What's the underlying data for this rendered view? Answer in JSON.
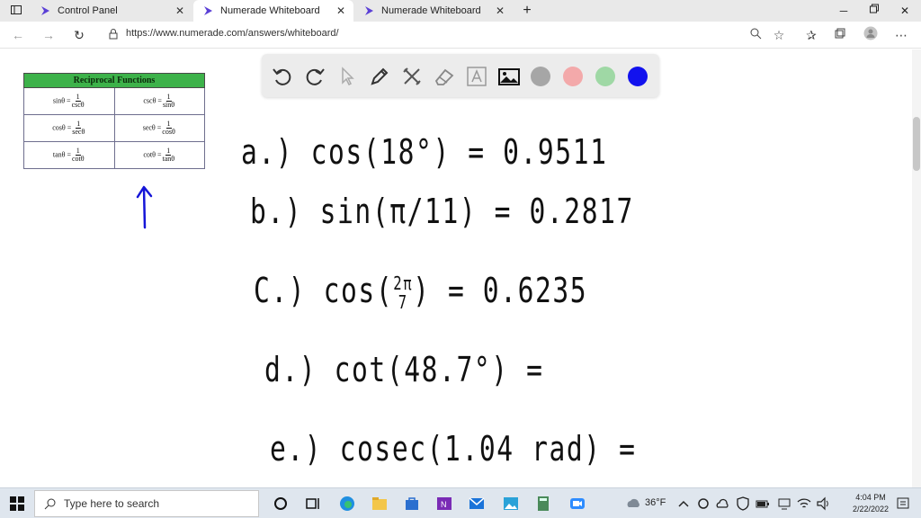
{
  "tabs": [
    {
      "title": "Control Panel"
    },
    {
      "title": "Numerade Whiteboard"
    },
    {
      "title": "Numerade Whiteboard"
    }
  ],
  "address": {
    "url": "https://www.numerade.com/answers/whiteboard/"
  },
  "table": {
    "title": "Reciprocal Functions",
    "rows": [
      {
        "l_lhs": "sinθ =",
        "l_num": "1",
        "l_den": "cscθ",
        "r_lhs": "cscθ =",
        "r_num": "1",
        "r_den": "sinθ"
      },
      {
        "l_lhs": "cosθ =",
        "l_num": "1",
        "l_den": "secθ",
        "r_lhs": "secθ =",
        "r_num": "1",
        "r_den": "cosθ"
      },
      {
        "l_lhs": "tanθ =",
        "l_num": "1",
        "l_den": "cotθ",
        "r_lhs": "cotθ =",
        "r_num": "1",
        "r_den": "tanθ"
      }
    ]
  },
  "toolbar": {
    "colors": {
      "gray": "#a6a6a6",
      "pink": "#f3a9aa",
      "green": "#9fd8a5",
      "blue": "#1212ee"
    }
  },
  "work": {
    "a": "a.) cos(18°) = 0.9511",
    "b": "b.) sin(π/11) = 0.2817",
    "c_pre": "C.) cos(",
    "c_num": "2π",
    "c_den": "7",
    "c_post": ") = 0.6235",
    "d": "d.) cot(48.7°) =",
    "e": "e.) cosec(1.04 rad) ="
  },
  "taskbar": {
    "search_placeholder": "Type here to search",
    "temperature": "36°F",
    "time": "4:04 PM",
    "date": "2/22/2022"
  }
}
